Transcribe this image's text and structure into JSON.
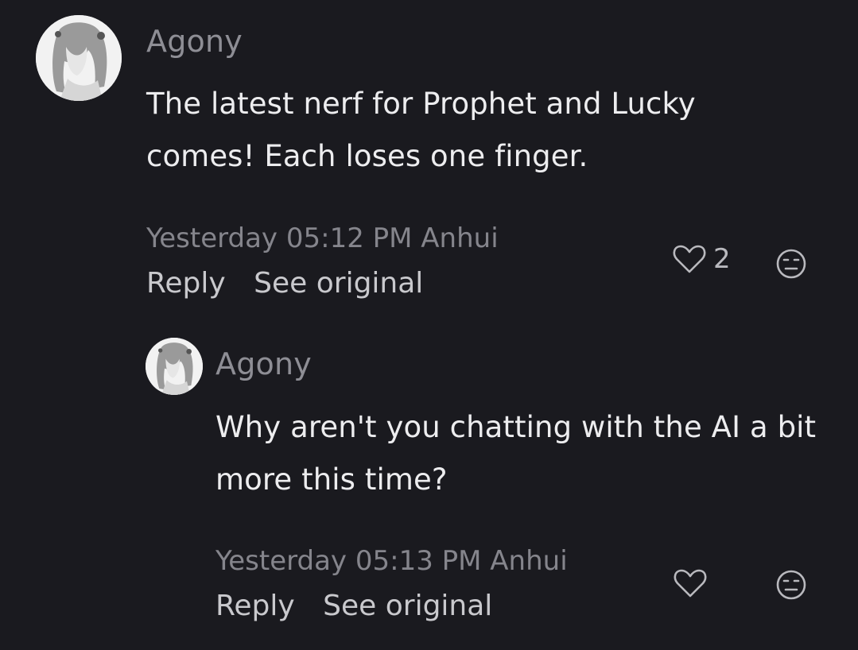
{
  "comments": [
    {
      "username": "Agony",
      "text": "The latest nerf for Prophet and Lucky comes! Each loses one finger.",
      "meta": "Yesterday 05:12 PM Anhui",
      "reply_label": "Reply",
      "see_original_label": "See original",
      "like_count": "2",
      "icons": {
        "like": "heart-outline-icon",
        "reaction": "neutral-face-icon"
      }
    },
    {
      "username": "Agony",
      "text": "Why aren't you chatting with the AI a bit more this time?",
      "meta": "Yesterday 05:13 PM Anhui",
      "reply_label": "Reply",
      "see_original_label": "See original",
      "like_count": "",
      "icons": {
        "like": "heart-outline-icon",
        "reaction": "neutral-face-icon"
      }
    }
  ],
  "colors": {
    "background": "#1a1a1f",
    "username": "#8e8e95",
    "text": "#ededef",
    "meta": "#85858c",
    "actions": "#c9c9cd"
  }
}
